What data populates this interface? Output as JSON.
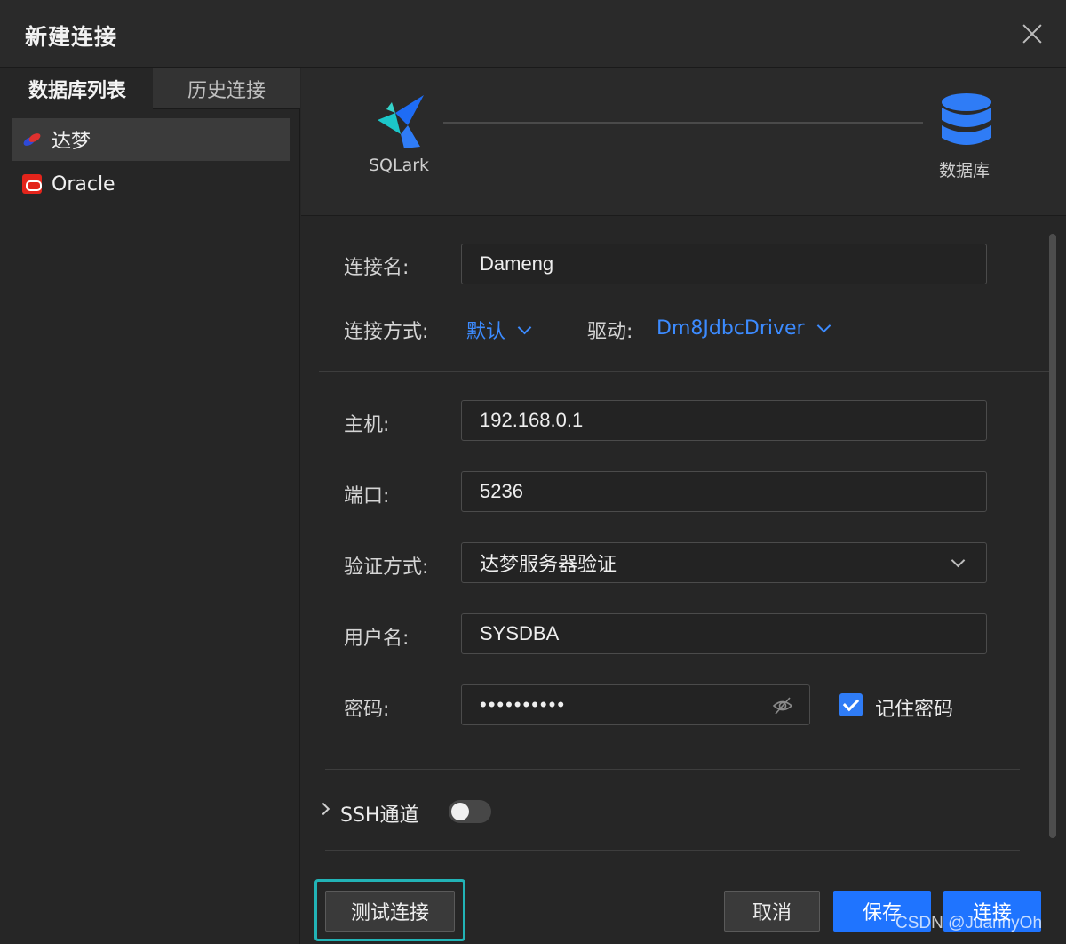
{
  "window": {
    "title": "新建连接"
  },
  "left_panel": {
    "tabs": [
      {
        "label": "数据库列表",
        "active": true
      },
      {
        "label": "历史连接",
        "active": false
      }
    ],
    "databases": [
      {
        "label": "达梦",
        "icon": "dameng-icon",
        "selected": true
      },
      {
        "label": "Oracle",
        "icon": "oracle-icon",
        "selected": false
      }
    ]
  },
  "header": {
    "source_label": "SQLark",
    "target_label": "数据库"
  },
  "form": {
    "connection_name": {
      "label": "连接名:",
      "value": "Dameng"
    },
    "connection_method": {
      "label": "连接方式:",
      "value": "默认"
    },
    "driver": {
      "label": "驱动:",
      "value": "Dm8JdbcDriver"
    },
    "host": {
      "label": "主机:",
      "value": "192.168.0.1"
    },
    "port": {
      "label": "端口:",
      "value": "5236"
    },
    "auth_method": {
      "label": "验证方式:",
      "value": "达梦服务器验证"
    },
    "username": {
      "label": "用户名:",
      "value": "SYSDBA"
    },
    "password": {
      "label": "密码:",
      "value": "••••••••••"
    },
    "remember_password": {
      "label": "记住密码",
      "checked": true
    },
    "ssh": {
      "label": "SSH通道",
      "enabled": false
    }
  },
  "buttons": {
    "test": "测试连接",
    "cancel": "取消",
    "save": "保存",
    "connect": "连接"
  },
  "watermark": "CSDN @JuannyOh",
  "colors": {
    "accent": "#1f74ff",
    "link": "#3c8bff",
    "highlight": "#22b3b6",
    "background": "#262626"
  }
}
